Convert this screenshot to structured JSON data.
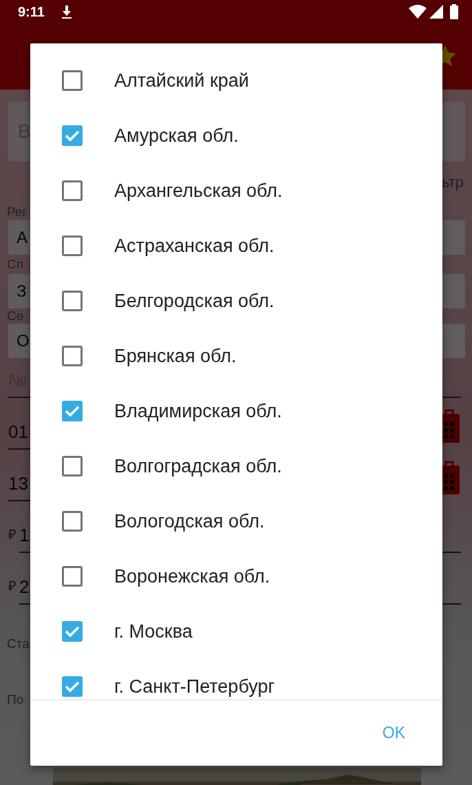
{
  "status_bar": {
    "time": "9:11"
  },
  "background_form": {
    "search_text": "В",
    "filter_text": "ьтр",
    "rows": [
      {
        "kind": "label",
        "text": "Рег"
      },
      {
        "kind": "select",
        "text": "А"
      },
      {
        "kind": "label",
        "text": "Сп"
      },
      {
        "kind": "select",
        "text": "З"
      },
      {
        "kind": "label",
        "text": "Се"
      },
      {
        "kind": "select",
        "text": "О"
      },
      {
        "kind": "hint",
        "text": "№"
      },
      {
        "kind": "date",
        "text": "01"
      },
      {
        "kind": "date",
        "text": "13"
      },
      {
        "kind": "money",
        "prefix": "₽",
        "text": "1"
      },
      {
        "kind": "money",
        "prefix": "₽",
        "text": "2"
      },
      {
        "kind": "caption",
        "text": "Ста"
      },
      {
        "kind": "caption",
        "text": "По"
      }
    ]
  },
  "dialog": {
    "regions": [
      {
        "label": "Алтайский край",
        "checked": false
      },
      {
        "label": "Амурская обл.",
        "checked": true
      },
      {
        "label": "Архангельская обл.",
        "checked": false
      },
      {
        "label": "Астраханская обл.",
        "checked": false
      },
      {
        "label": "Белгородская обл.",
        "checked": false
      },
      {
        "label": "Брянская обл.",
        "checked": false
      },
      {
        "label": "Владимирская обл.",
        "checked": true
      },
      {
        "label": "Волгоградская обл.",
        "checked": false
      },
      {
        "label": "Вологодская обл.",
        "checked": false
      },
      {
        "label": "Воронежская обл.",
        "checked": false
      },
      {
        "label": "г. Москва",
        "checked": true
      },
      {
        "label": "г. Санкт-Петербург",
        "checked": true
      }
    ],
    "ok_button": "OK"
  }
}
